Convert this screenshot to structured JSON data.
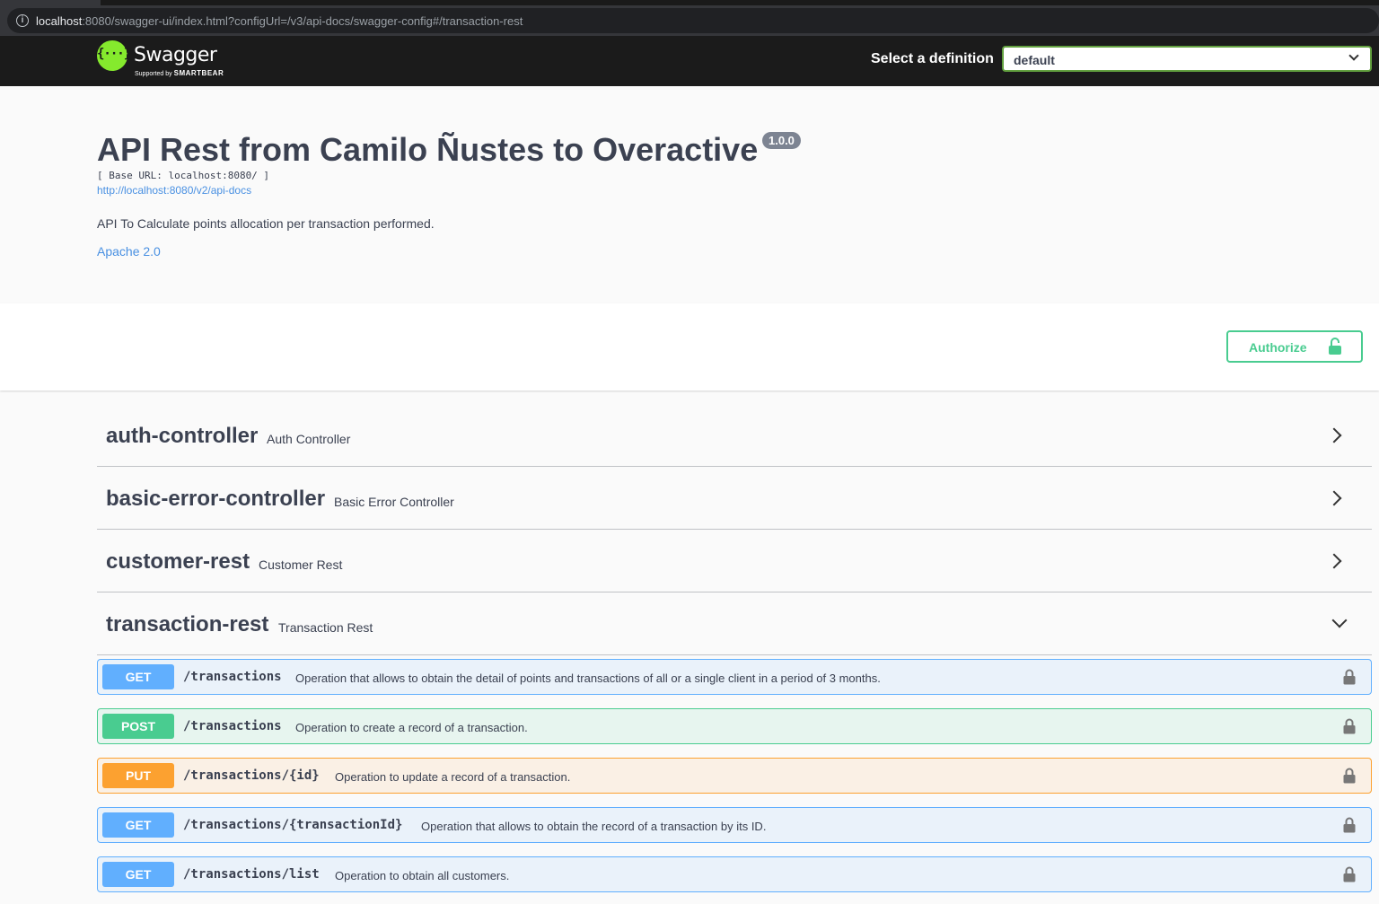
{
  "browser": {
    "url_host": "localhost",
    "url_rest": ":8080/swagger-ui/index.html?configUrl=/v3/api-docs/swagger-config#/transaction-rest"
  },
  "topbar": {
    "logo_text": "Swagger",
    "logo_sub_prefix": "Supported by",
    "logo_sub_brand": "SMARTBEAR",
    "select_label": "Select a definition",
    "select_value": "default"
  },
  "info": {
    "title": "API Rest from Camilo Ñustes to Overactive",
    "version": "1.0.0",
    "base_url": "[ Base URL: localhost:8080/ ]",
    "docs_link": "http://localhost:8080/v2/api-docs",
    "description": "API To Calculate points allocation per transaction performed.",
    "license": "Apache 2.0"
  },
  "authorize": {
    "label": "Authorize"
  },
  "tags": [
    {
      "name": "auth-controller",
      "description": "Auth Controller",
      "expanded": false
    },
    {
      "name": "basic-error-controller",
      "description": "Basic Error Controller",
      "expanded": false
    },
    {
      "name": "customer-rest",
      "description": "Customer Rest",
      "expanded": false
    },
    {
      "name": "transaction-rest",
      "description": "Transaction Rest",
      "expanded": true
    }
  ],
  "operations": [
    {
      "method": "GET",
      "path": "/transactions",
      "summary": "Operation that allows to obtain the detail of points and transactions of all or a single client in a period of 3 months."
    },
    {
      "method": "POST",
      "path": "/transactions",
      "summary": "Operation to create a record of a transaction."
    },
    {
      "method": "PUT",
      "path": "/transactions/{id}",
      "summary": "Operation to update a record of a transaction."
    },
    {
      "method": "GET",
      "path": "/transactions/{transactionId}",
      "summary": "Operation that allows to obtain the record of a transaction by its ID."
    },
    {
      "method": "GET",
      "path": "/transactions/list",
      "summary": "Operation to obtain all customers."
    }
  ],
  "colors": {
    "get": "#61affe",
    "post": "#49cc90",
    "put": "#fca130",
    "link": "#4990e2",
    "logo": "#85ea2d"
  }
}
